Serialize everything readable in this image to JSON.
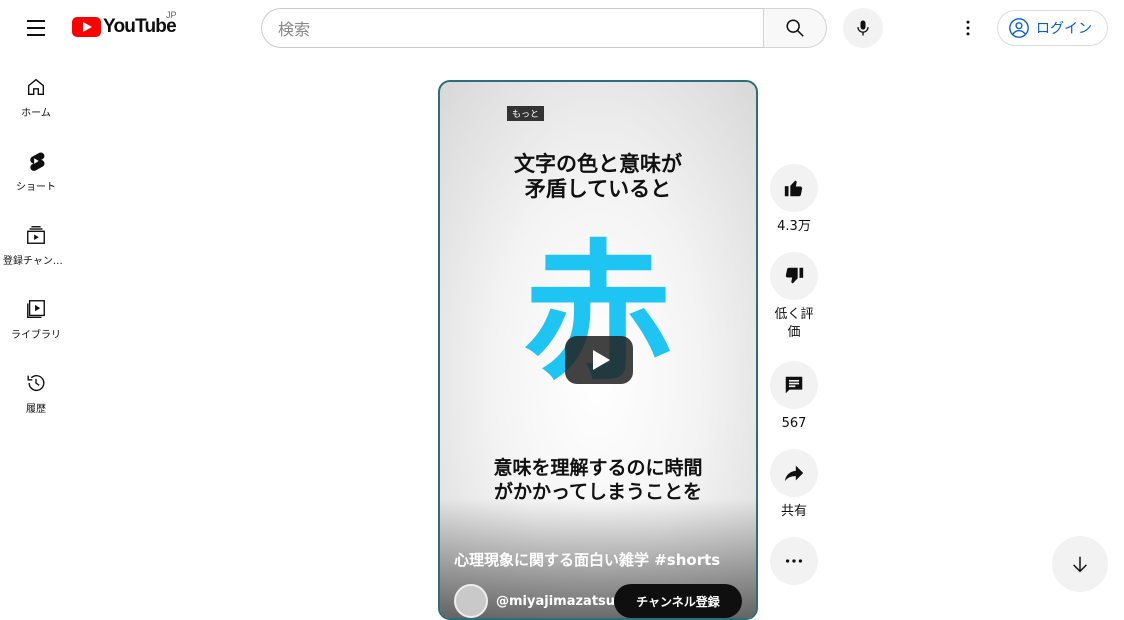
{
  "header": {
    "logo_text": "YouTube",
    "country": "JP",
    "search_placeholder": "検索",
    "login_label": "ログイン"
  },
  "sidebar": {
    "items": [
      {
        "label": "ホーム",
        "icon": "home-icon"
      },
      {
        "label": "ショート",
        "icon": "shorts-icon"
      },
      {
        "label": "登録チャンネル",
        "icon": "subscriptions-icon"
      },
      {
        "label": "ライブラリ",
        "icon": "library-icon"
      },
      {
        "label": "履歴",
        "icon": "history-icon"
      }
    ]
  },
  "video": {
    "tag": "もっと",
    "top_text_line1": "文字の色と意味が",
    "top_text_line2": "矛盾していると",
    "big_char": "赤",
    "bottom_text_line1": "意味を理解するのに時間",
    "bottom_text_line2": "がかかってしまうことを",
    "title": "心理現象に関する面白い雑学 #shorts",
    "channel": "@miyajimazatsug",
    "subscribe_label": "チャンネル登録"
  },
  "actions": {
    "like_count": "4.3万",
    "dislike_label_line1": "低く評",
    "dislike_label_line2": "価",
    "comment_count": "567",
    "share_label": "共有"
  }
}
